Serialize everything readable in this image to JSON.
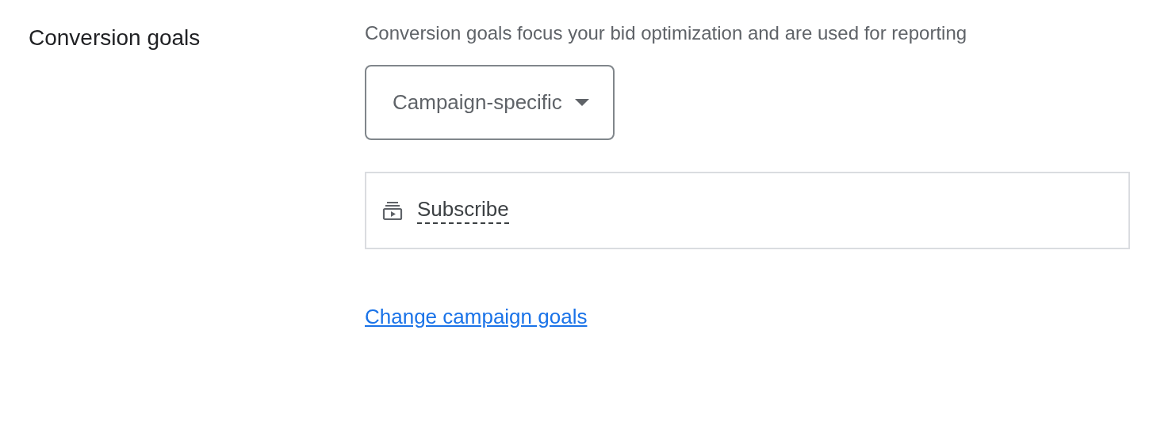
{
  "section": {
    "title": "Conversion goals",
    "description": "Conversion goals focus your bid optimization and are used for reporting"
  },
  "dropdown": {
    "value": "Campaign-specific"
  },
  "goals": [
    {
      "label": "Subscribe"
    }
  ],
  "link": {
    "label": "Change campaign goals"
  }
}
